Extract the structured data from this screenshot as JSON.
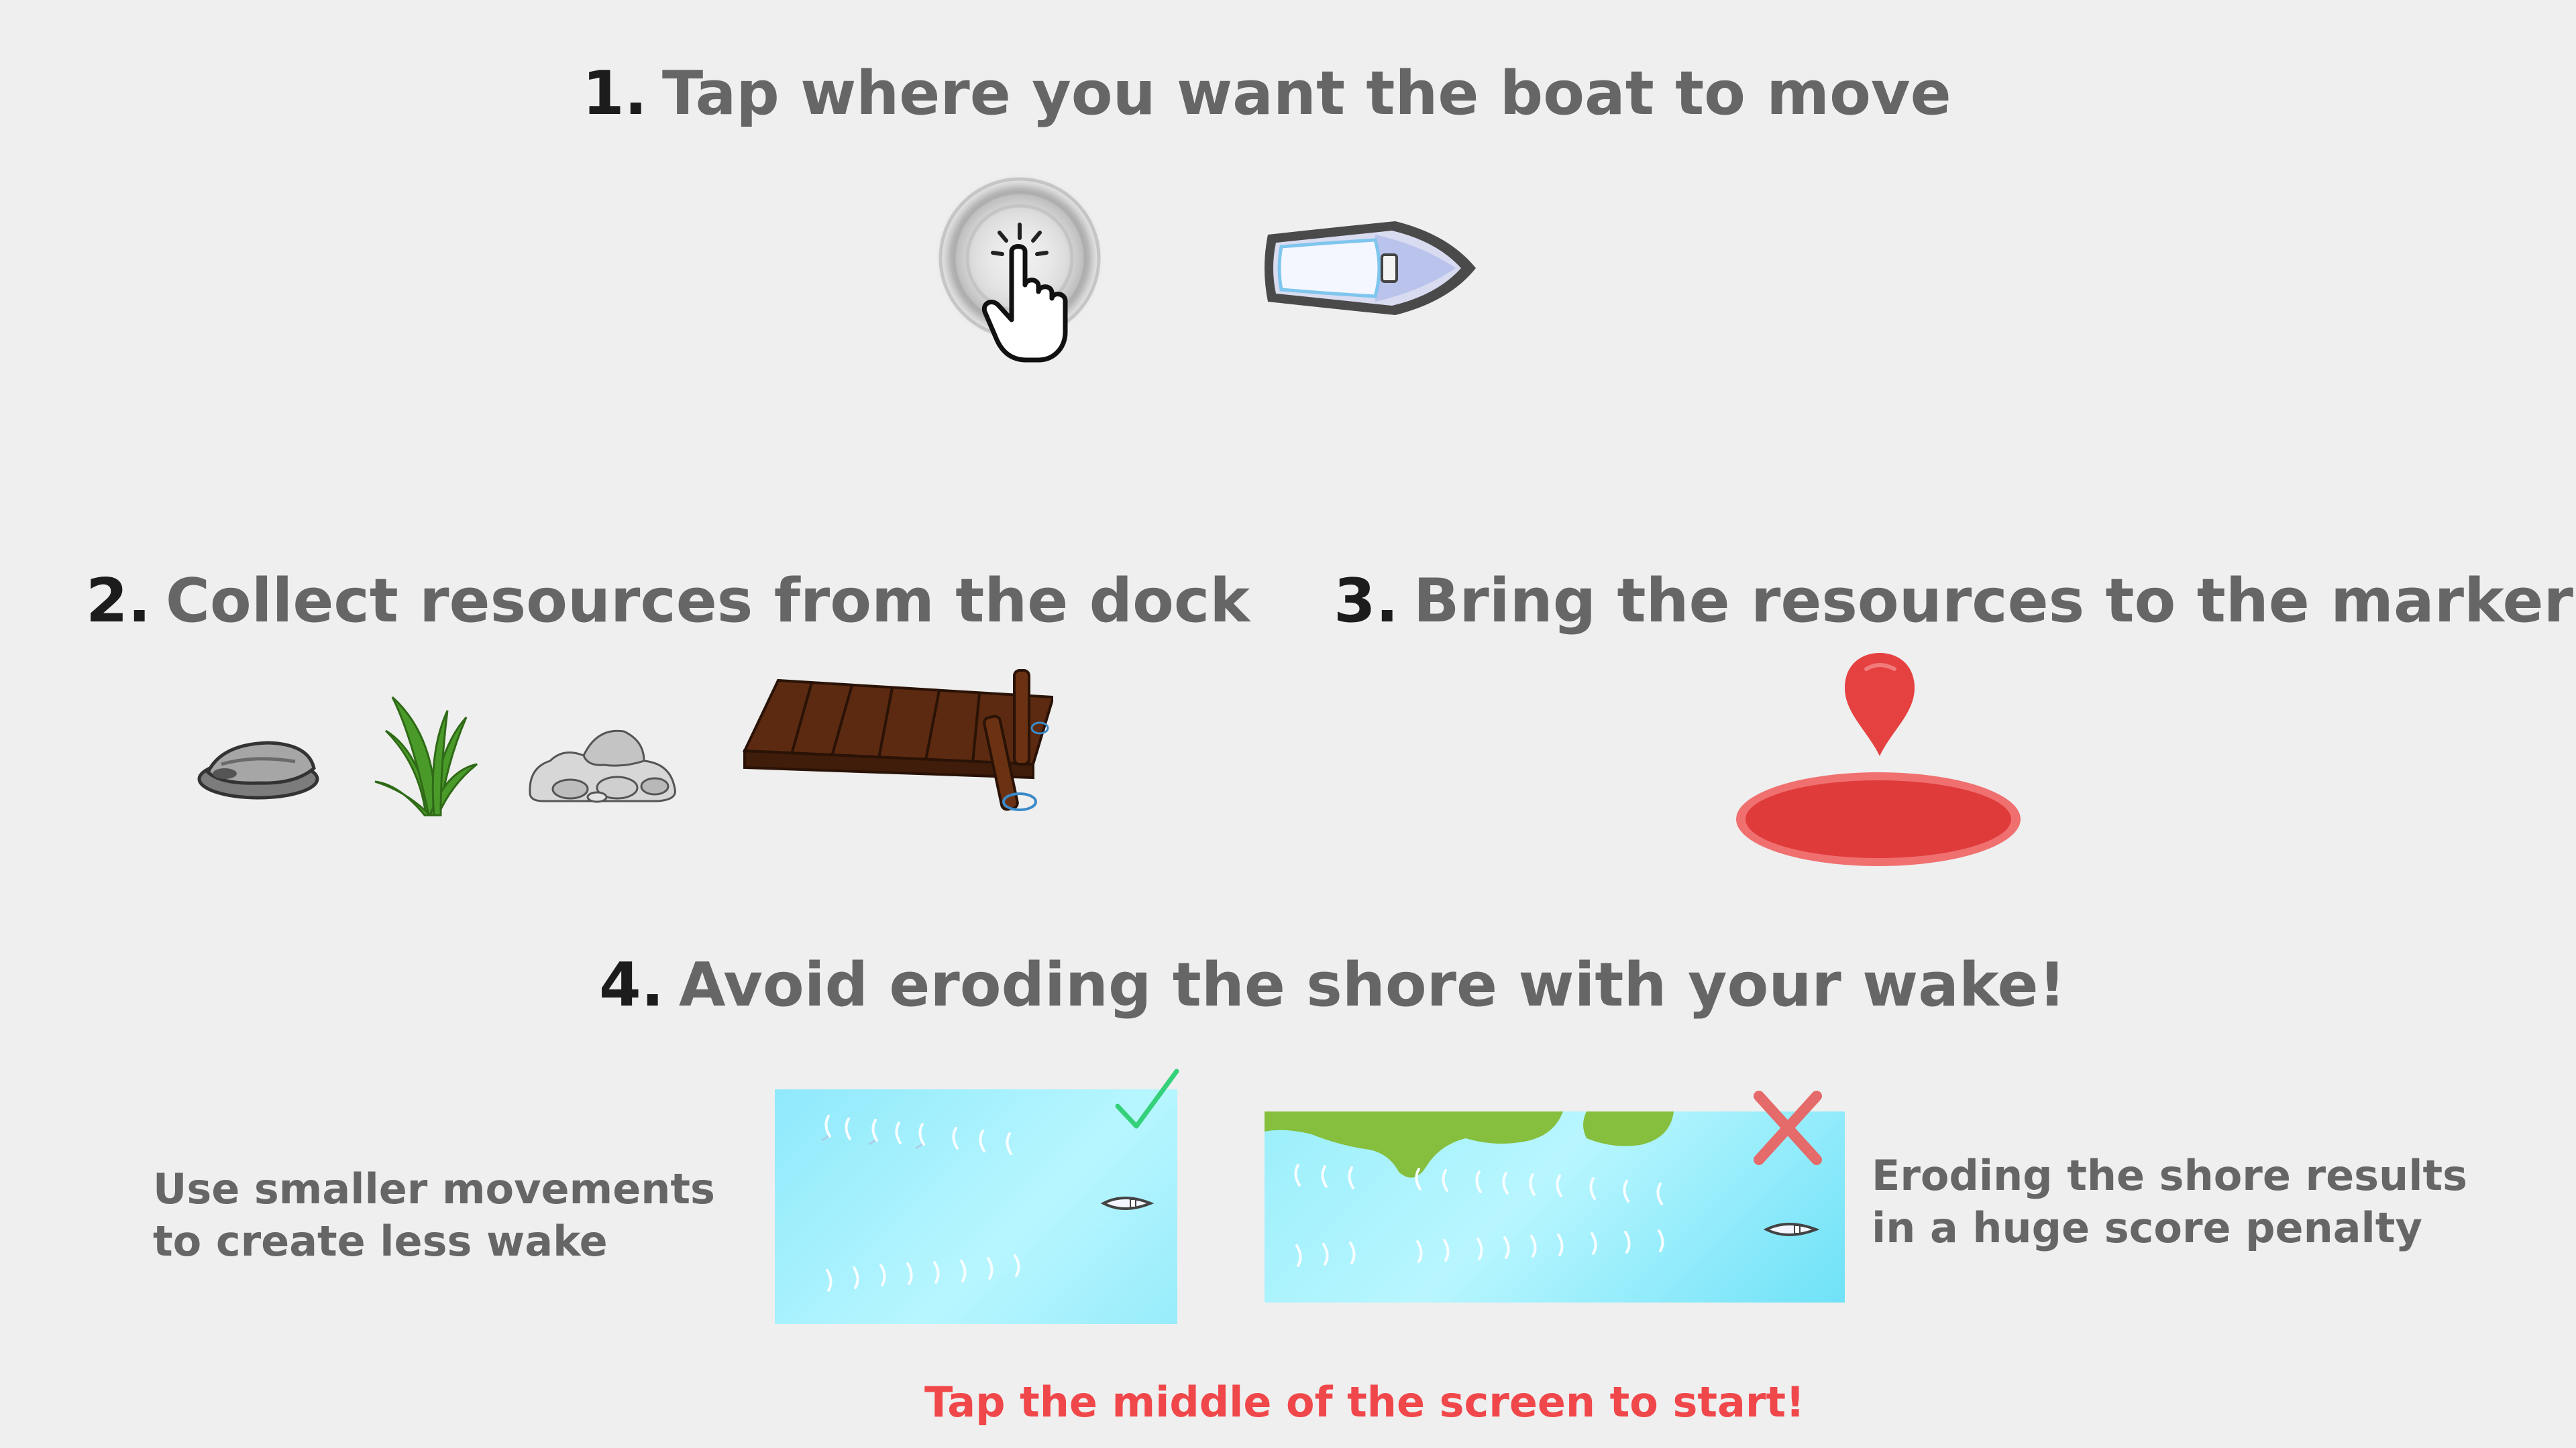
{
  "steps": [
    {
      "number": "1.",
      "text": "Tap where you want the boat to move"
    },
    {
      "number": "2.",
      "text": "Collect resources from the dock"
    },
    {
      "number": "3.",
      "text": "Bring the resources to the marker"
    },
    {
      "number": "4.",
      "text": "Avoid eroding the shore with your wake!"
    }
  ],
  "tips": {
    "good": "Use smaller movements to create less wake",
    "bad": "Eroding the shore results in a huge score penalty"
  },
  "start_prompt": "Tap the middle of the screen to start!",
  "colors": {
    "background": "#efefef",
    "accent_red": "#f0474b",
    "marker_red": "#e53e3e",
    "check_green": "#34d17a",
    "water_cyan": "#6fe2f7",
    "shore_green": "#86bf3e"
  },
  "icons": [
    "tap-icon",
    "boat-icon",
    "clam-icon",
    "seagrass-icon",
    "rocks-icon",
    "dock-icon",
    "marker-pin-icon",
    "marker-base-icon",
    "checkmark-icon",
    "cross-icon"
  ]
}
